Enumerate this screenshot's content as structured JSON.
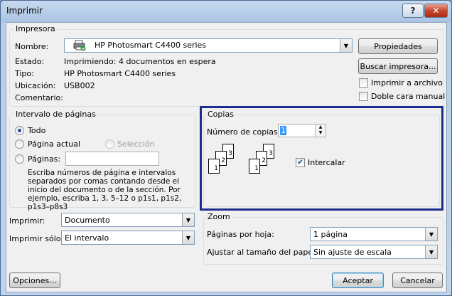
{
  "window": {
    "title": "Imprimir"
  },
  "printer": {
    "group_label": "Impresora",
    "name_label": "Nombre:",
    "name_value": "HP Photosmart C4400 series",
    "status_label": "Estado:",
    "status_value": "Imprimiendo: 4 documentos en espera",
    "type_label": "Tipo:",
    "type_value": "HP Photosmart C4400 series",
    "location_label": "Ubicación:",
    "location_value": "USB002",
    "comment_label": "Comentario:",
    "properties_button": "Propiedades",
    "find_printer_button": "Buscar impresora...",
    "print_to_file_label": "Imprimir a archivo",
    "duplex_label": "Doble cara manual"
  },
  "page_range": {
    "group_label": "Intervalo de páginas",
    "all_label": "Todo",
    "current_page_label": "Página actual",
    "selection_label": "Selección",
    "pages_label": "Páginas:",
    "pages_value": "",
    "help_text": "Escriba números de página e intervalos separados por comas contando desde el inicio del documento o de la sección. Por ejemplo, escriba 1, 3, 5–12 o p1s1, p1s2, p1s3–p8s3"
  },
  "copies": {
    "group_label": "Copias",
    "count_label": "Número de copias:",
    "count_value": "1",
    "collate_label": "Intercalar",
    "collate_checked": true,
    "page_labels": [
      "1",
      "2",
      "3"
    ]
  },
  "print_what": {
    "print_label": "Imprimir:",
    "print_value": "Documento",
    "print_only_label": "Imprimir sólo:",
    "print_only_value": "El intervalo"
  },
  "zoom": {
    "group_label": "Zoom",
    "pages_per_sheet_label": "Páginas por hoja:",
    "pages_per_sheet_value": "1 página",
    "scale_label": "Ajustar al tamaño del papel:",
    "scale_value": "Sin ajuste de escala"
  },
  "footer": {
    "options_button": "Opciones...",
    "ok_button": "Aceptar",
    "cancel_button": "Cancelar"
  },
  "colors": {
    "highlight_border": "#1c2d8f",
    "close_red": "#c4452e"
  }
}
